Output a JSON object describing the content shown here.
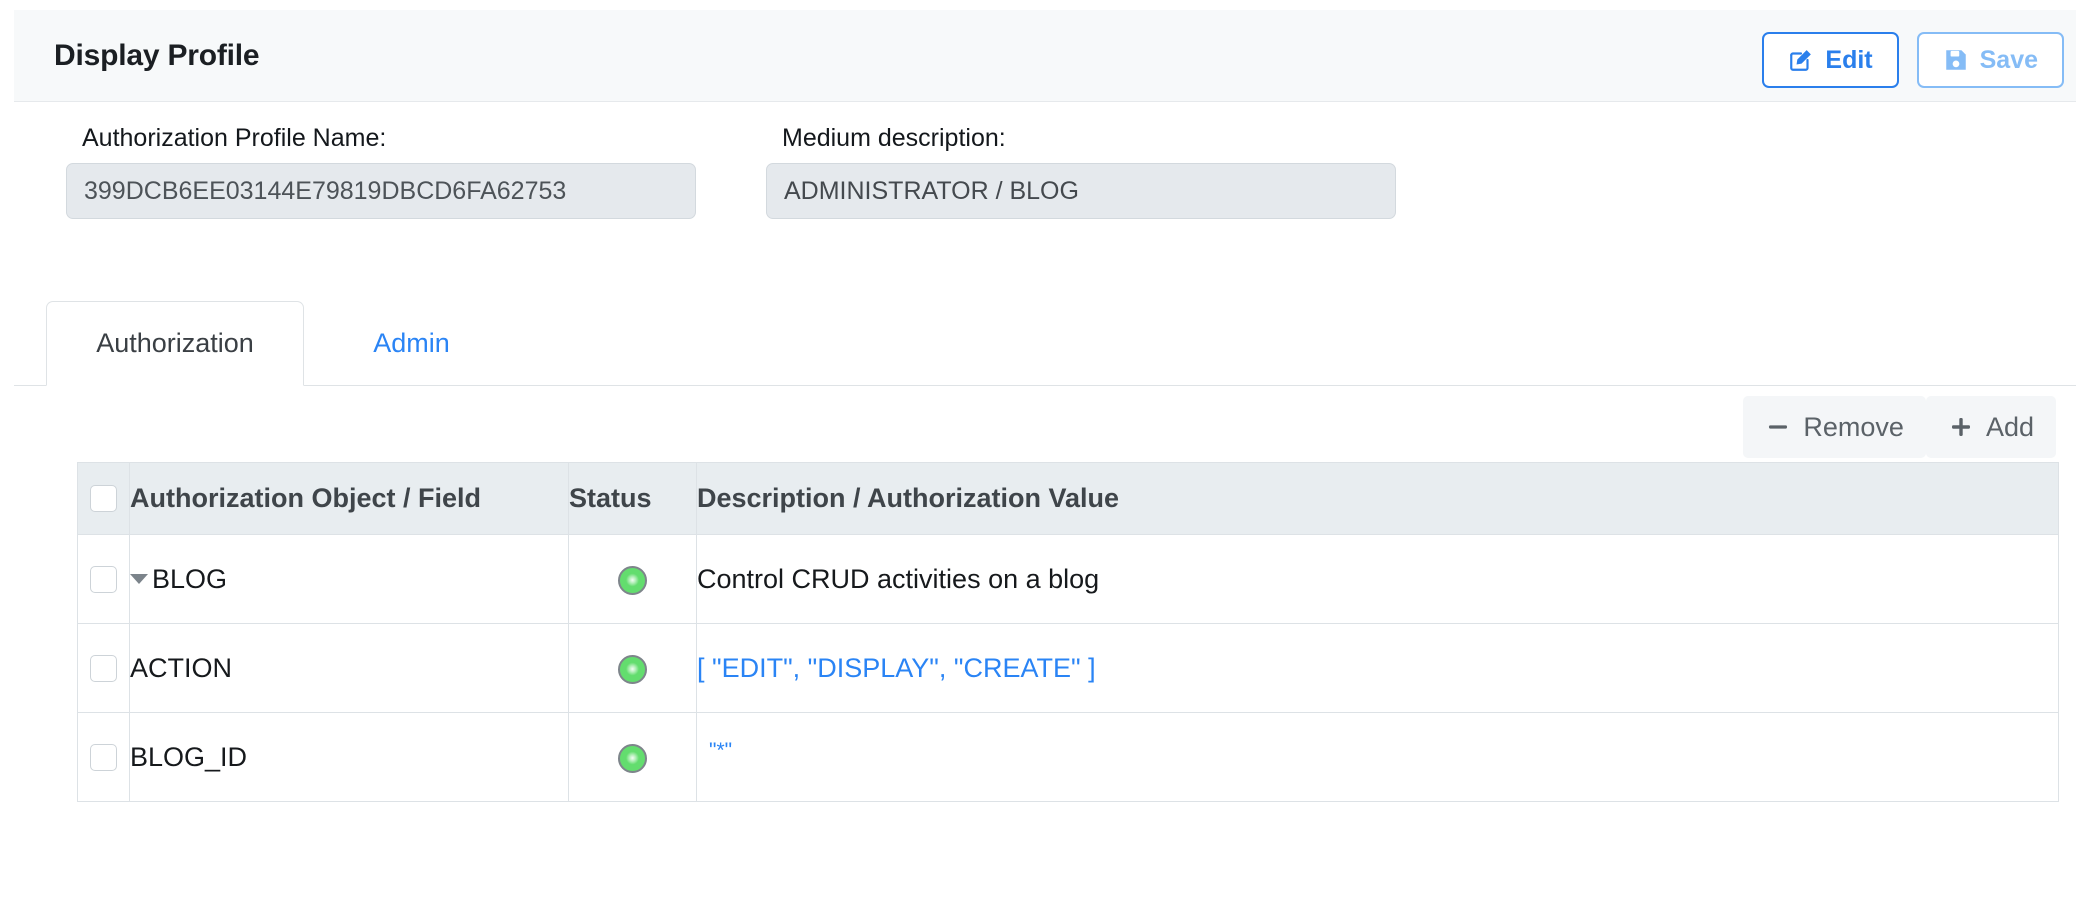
{
  "header": {
    "title": "Display Profile",
    "actions": [
      {
        "label": "Edit",
        "icon": "edit-pencil-square-icon",
        "state": "enabled",
        "color": "#2a7fec"
      },
      {
        "label": "Save",
        "icon": "floppy-disk-save-icon",
        "state": "disabled",
        "color": "#85bcf6"
      }
    ]
  },
  "form": {
    "profile_name": {
      "label": "Authorization Profile Name:",
      "value": "399DCB6EE03144E79819DBCD6FA62753"
    },
    "medium_description": {
      "label": "Medium description:",
      "value": "ADMINISTRATOR / BLOG"
    }
  },
  "tabs": [
    {
      "label": "Authorization",
      "active": true
    },
    {
      "label": "Admin",
      "active": false
    }
  ],
  "table_toolbar": {
    "remove": {
      "label": "Remove",
      "icon": "minus-icon"
    },
    "add": {
      "label": "Add",
      "icon": "plus-icon"
    }
  },
  "table": {
    "columns": [
      "",
      "Authorization Object / Field",
      "Status",
      "Description / Authorization Value"
    ],
    "rows": [
      {
        "object": "BLOG",
        "level": 0,
        "expanded": true,
        "expander_icon": "caret-down-icon",
        "status": "green",
        "status_icon": "green-led-icon",
        "description": "Control CRUD activities on a blog",
        "description_is_link": false,
        "checked": false
      },
      {
        "object": "ACTION",
        "level": 1,
        "status": "green",
        "status_icon": "green-led-icon",
        "description": "[ \"EDIT\", \"DISPLAY\", \"CREATE\" ]",
        "description_is_link": true,
        "checked": false
      },
      {
        "object": "BLOG_ID",
        "level": 1,
        "status": "green",
        "status_icon": "green-led-icon",
        "description": "\"*\"",
        "description_is_link": true,
        "description_small": true,
        "checked": false
      }
    ]
  },
  "colors": {
    "accent_blue": "#2a84f5",
    "status_green": "#63dd6e",
    "header_bg": "#f7f9fa",
    "table_header_bg": "#e8edf0"
  }
}
